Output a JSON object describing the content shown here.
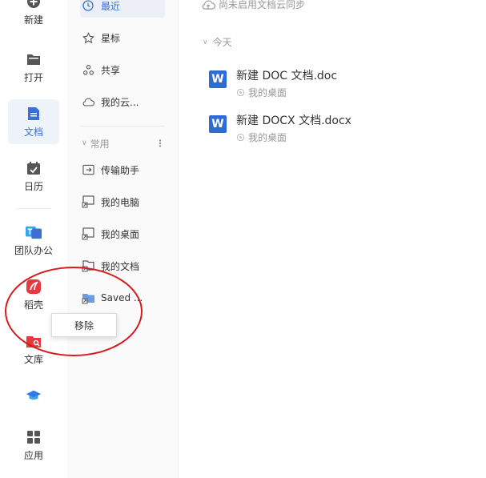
{
  "rail": {
    "items": [
      {
        "label": "新建",
        "icon": "plus-circle-icon"
      },
      {
        "label": "打开",
        "icon": "folder-icon"
      },
      {
        "label": "文档",
        "icon": "document-icon",
        "active": true
      },
      {
        "label": "日历",
        "icon": "calendar-icon"
      },
      {
        "label": "团队办公",
        "icon": "team-office-icon"
      },
      {
        "label": "稻壳",
        "icon": "docer-icon"
      },
      {
        "label": "文库",
        "icon": "library-icon"
      },
      {
        "label": "",
        "icon": "graduation-cap-icon"
      },
      {
        "label": "应用",
        "icon": "apps-grid-icon"
      }
    ]
  },
  "nav": {
    "top_items": [
      {
        "label": "最近",
        "icon": "clock-icon",
        "active": true
      },
      {
        "label": "星标",
        "icon": "star-icon"
      },
      {
        "label": "共享",
        "icon": "share-icon"
      },
      {
        "label": "我的云...",
        "icon": "cloud-icon"
      }
    ],
    "section_label": "常用",
    "section_more": "⋮",
    "common_items": [
      {
        "label": "传输助手",
        "icon": "transfer-icon"
      },
      {
        "label": "我的电脑",
        "icon": "computer-shortcut-icon"
      },
      {
        "label": "我的桌面",
        "icon": "desktop-shortcut-icon"
      },
      {
        "label": "我的文档",
        "icon": "documents-shortcut-icon"
      },
      {
        "label": "Saved ...",
        "icon": "folder-shortcut-icon"
      }
    ]
  },
  "main": {
    "sync_status": "尚未启用文档云同步",
    "group_label": "今天",
    "files": [
      {
        "name": "新建 DOC 文档.doc",
        "location": "我的桌面",
        "icon_letter": "W"
      },
      {
        "name": "新建 DOCX 文档.docx",
        "location": "我的桌面",
        "icon_letter": "W"
      }
    ]
  },
  "context_menu": {
    "remove_label": "移除"
  },
  "colors": {
    "accent": "#3b6fd8",
    "word_blue": "#2f6bd6",
    "annotation_red": "#d9191c"
  }
}
